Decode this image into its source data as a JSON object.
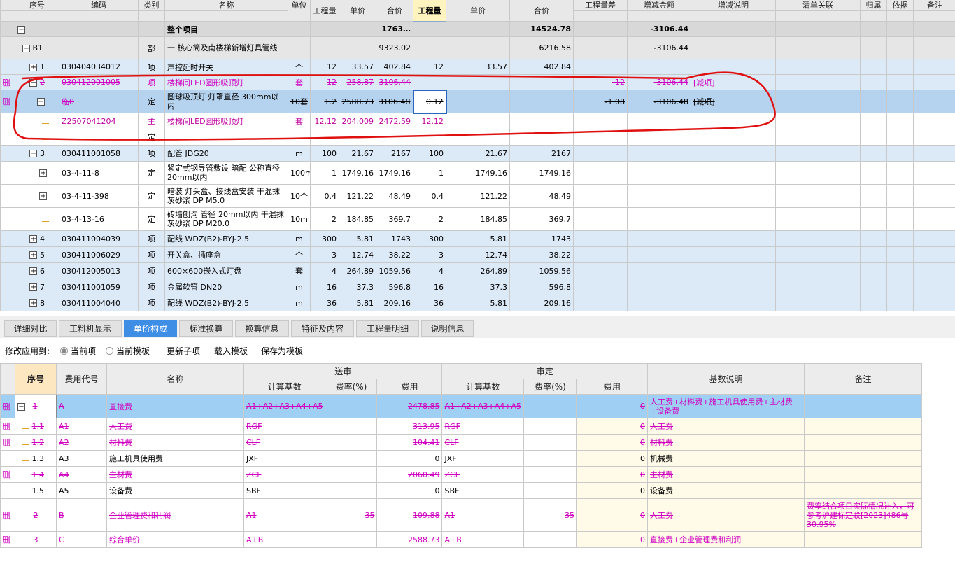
{
  "top": {
    "header1": [
      "序号",
      "编码",
      "类别",
      "名称",
      "单位",
      "",
      "",
      "",
      "",
      "",
      "",
      "工程量差",
      "增减金额",
      "增减说明",
      "清单关联",
      "归属",
      "依据",
      "备注"
    ],
    "header2": [
      "工程量",
      "单价",
      "合价",
      "工程量",
      "单价",
      "合价"
    ],
    "rows": [
      {
        "seq": "",
        "code": "",
        "type": "",
        "name": "整个项目",
        "unit": "",
        "q1": "",
        "p1": "",
        "t1": "1763…",
        "q2": "",
        "p2": "",
        "t2": "14524.78",
        "diff": "",
        "amt": "-3106.44",
        "note": "",
        "mark": ""
      },
      {
        "seq": "B1",
        "code": "",
        "type": "部",
        "name": "一 核心筒及南楼梯新增灯具管线",
        "unit": "",
        "q1": "",
        "p1": "",
        "t1": "9323.02",
        "q2": "",
        "p2": "",
        "t2": "6216.58",
        "diff": "",
        "amt": "-3106.44",
        "note": "",
        "mark": ""
      },
      {
        "seq": "1",
        "code": "030404034012",
        "type": "项",
        "name": "声控延时开关",
        "unit": "个",
        "q1": "12",
        "p1": "33.57",
        "t1": "402.84",
        "q2": "12",
        "p2": "33.57",
        "t2": "402.84",
        "diff": "",
        "amt": "",
        "note": "",
        "mark": ""
      },
      {
        "seq": "2",
        "code": "030412001005",
        "type": "项",
        "name": "楼梯间LED圆形吸顶灯",
        "unit": "套",
        "q1": "12",
        "p1": "258.87",
        "t1": "3106.44",
        "q2": "",
        "p2": "",
        "t2": "",
        "diff": "-12",
        "amt": "-3106.44",
        "note": "[减项]",
        "mark": "删"
      },
      {
        "seq": "临0",
        "code": "",
        "type": "定",
        "name": "圆球吸顶灯 灯罩直径 300mm以内",
        "unit": "10套",
        "q1": "1.2",
        "p1": "2588.73",
        "t1": "3106.48",
        "q2": "0.12",
        "p2": "",
        "t2": "",
        "diff": "-1.08",
        "amt": "-3106.48",
        "note": "[减项]",
        "mark": "删"
      },
      {
        "seq": "",
        "code": "Z2507041204",
        "type": "主",
        "name": "楼梯间LED圆形吸顶灯",
        "unit": "套",
        "q1": "12.12",
        "p1": "204.009",
        "t1": "2472.59",
        "q2": "12.12",
        "p2": "",
        "t2": "",
        "diff": "",
        "amt": "",
        "note": "",
        "mark": ""
      },
      {
        "seq": "",
        "code": "",
        "type": "定",
        "name": "",
        "unit": "",
        "q1": "",
        "p1": "",
        "t1": "",
        "q2": "",
        "p2": "",
        "t2": "",
        "diff": "",
        "amt": "",
        "note": "",
        "mark": ""
      },
      {
        "seq": "3",
        "code": "030411001058",
        "type": "项",
        "name": "配管 JDG20",
        "unit": "m",
        "q1": "100",
        "p1": "21.67",
        "t1": "2167",
        "q2": "100",
        "p2": "21.67",
        "t2": "2167",
        "diff": "",
        "amt": "",
        "note": "",
        "mark": ""
      },
      {
        "seq": "",
        "code": "03-4-11-8",
        "type": "定",
        "name": "紧定式钢导管敷设 暗配 公称直径 20mm以内",
        "unit": "100m",
        "q1": "1",
        "p1": "1749.16",
        "t1": "1749.16",
        "q2": "1",
        "p2": "1749.16",
        "t2": "1749.16",
        "diff": "",
        "amt": "",
        "note": "",
        "mark": ""
      },
      {
        "seq": "",
        "code": "03-4-11-398",
        "type": "定",
        "name": "暗装 灯头盒、接线盒安装 干混抹灰砂浆 DP M5.0",
        "unit": "10个",
        "q1": "0.4",
        "p1": "121.22",
        "t1": "48.49",
        "q2": "0.4",
        "p2": "121.22",
        "t2": "48.49",
        "diff": "",
        "amt": "",
        "note": "",
        "mark": ""
      },
      {
        "seq": "",
        "code": "03-4-13-16",
        "type": "定",
        "name": "砖墙刨沟 管径 20mm以内 干混抹灰砂浆 DP M20.0",
        "unit": "10m",
        "q1": "2",
        "p1": "184.85",
        "t1": "369.7",
        "q2": "2",
        "p2": "184.85",
        "t2": "369.7",
        "diff": "",
        "amt": "",
        "note": "",
        "mark": ""
      },
      {
        "seq": "4",
        "code": "030411004039",
        "type": "项",
        "name": "配线 WDZ(B2)-BYJ-2.5",
        "unit": "m",
        "q1": "300",
        "p1": "5.81",
        "t1": "1743",
        "q2": "300",
        "p2": "5.81",
        "t2": "1743",
        "diff": "",
        "amt": "",
        "note": "",
        "mark": ""
      },
      {
        "seq": "5",
        "code": "030411006029",
        "type": "项",
        "name": "开关盒、插座盒",
        "unit": "个",
        "q1": "3",
        "p1": "12.74",
        "t1": "38.22",
        "q2": "3",
        "p2": "12.74",
        "t2": "38.22",
        "diff": "",
        "amt": "",
        "note": "",
        "mark": ""
      },
      {
        "seq": "6",
        "code": "030412005013",
        "type": "项",
        "name": "600×600嵌入式灯盘",
        "unit": "套",
        "q1": "4",
        "p1": "264.89",
        "t1": "1059.56",
        "q2": "4",
        "p2": "264.89",
        "t2": "1059.56",
        "diff": "",
        "amt": "",
        "note": "",
        "mark": ""
      },
      {
        "seq": "7",
        "code": "030411001059",
        "type": "项",
        "name": "金属软管 DN20",
        "unit": "m",
        "q1": "16",
        "p1": "37.3",
        "t1": "596.8",
        "q2": "16",
        "p2": "37.3",
        "t2": "596.8",
        "diff": "",
        "amt": "",
        "note": "",
        "mark": ""
      },
      {
        "seq": "8",
        "code": "030411004040",
        "type": "项",
        "name": "配线 WDZ(B2)-BYJ-2.5",
        "unit": "m",
        "q1": "36",
        "p1": "5.81",
        "t1": "209.16",
        "q2": "36",
        "p2": "5.81",
        "t2": "209.16",
        "diff": "",
        "amt": "",
        "note": "",
        "mark": ""
      }
    ]
  },
  "tabs": [
    "详细对比",
    "工料机显示",
    "单价构成",
    "标准换算",
    "换算信息",
    "特征及内容",
    "工程量明细",
    "说明信息"
  ],
  "options": {
    "label": "修改应用到:",
    "radio_current_item": "当前项",
    "radio_current_template": "当前模板",
    "update_child": "更新子项",
    "load_template": "载入模板",
    "save_template": "保存为模板"
  },
  "bottom": {
    "header_seq": "序号",
    "header_code": "费用代号",
    "header_name": "名称",
    "group_submit": "送审",
    "group_review": "审定",
    "header_base": "计算基数",
    "header_rate": "费率(%)",
    "header_fee": "费用",
    "header_desc": "基数说明",
    "header_remark": "备注",
    "rows": [
      {
        "mark": "删",
        "seq": "1",
        "code": "A",
        "name": "直接费",
        "base1": "A1+A2+A3+A4+A5",
        "rate1": "",
        "fee1": "2478.85",
        "base2": "A1+A2+A3+A4+A5",
        "rate2": "",
        "fee2": "0",
        "desc": "人工费+材料费+施工机具使用费+主材费+设备费",
        "remark": ""
      },
      {
        "mark": "删",
        "seq": "1.1",
        "code": "A1",
        "name": "人工费",
        "base1": "RGF",
        "rate1": "",
        "fee1": "313.95",
        "base2": "RGF",
        "rate2": "",
        "fee2": "0",
        "desc": "人工费",
        "remark": ""
      },
      {
        "mark": "删",
        "seq": "1.2",
        "code": "A2",
        "name": "材料费",
        "base1": "CLF",
        "rate1": "",
        "fee1": "104.41",
        "base2": "CLF",
        "rate2": "",
        "fee2": "0",
        "desc": "材料费",
        "remark": ""
      },
      {
        "mark": "",
        "seq": "1.3",
        "code": "A3",
        "name": "施工机具使用费",
        "base1": "JXF",
        "rate1": "",
        "fee1": "0",
        "base2": "JXF",
        "rate2": "",
        "fee2": "0",
        "desc": "机械费",
        "remark": ""
      },
      {
        "mark": "删",
        "seq": "1.4",
        "code": "A4",
        "name": "主材费",
        "base1": "ZCF",
        "rate1": "",
        "fee1": "2060.49",
        "base2": "ZCF",
        "rate2": "",
        "fee2": "0",
        "desc": "主材费",
        "remark": ""
      },
      {
        "mark": "",
        "seq": "1.5",
        "code": "A5",
        "name": "设备费",
        "base1": "SBF",
        "rate1": "",
        "fee1": "0",
        "base2": "SBF",
        "rate2": "",
        "fee2": "0",
        "desc": "设备费",
        "remark": ""
      },
      {
        "mark": "删",
        "seq": "2",
        "code": "B",
        "name": "企业管理费和利润",
        "base1": "A1",
        "rate1": "35",
        "fee1": "109.88",
        "base2": "A1",
        "rate2": "35",
        "fee2": "0",
        "desc": "人工费",
        "remark": "费率结合项目实际情况计入，可参考沪建标定联[2023]486号30.95%"
      },
      {
        "mark": "删",
        "seq": "3",
        "code": "C",
        "name": "综合单价",
        "base1": "A+B",
        "rate1": "",
        "fee1": "2588.73",
        "base2": "A+B",
        "rate2": "",
        "fee2": "0",
        "desc": "直接费+企业管理费和利润",
        "remark": ""
      }
    ]
  },
  "colors": {
    "accent": "#3f8ee6",
    "deleted": "#d000c0",
    "annotation": "#e01010",
    "selected_row": "#b5d3ef"
  }
}
